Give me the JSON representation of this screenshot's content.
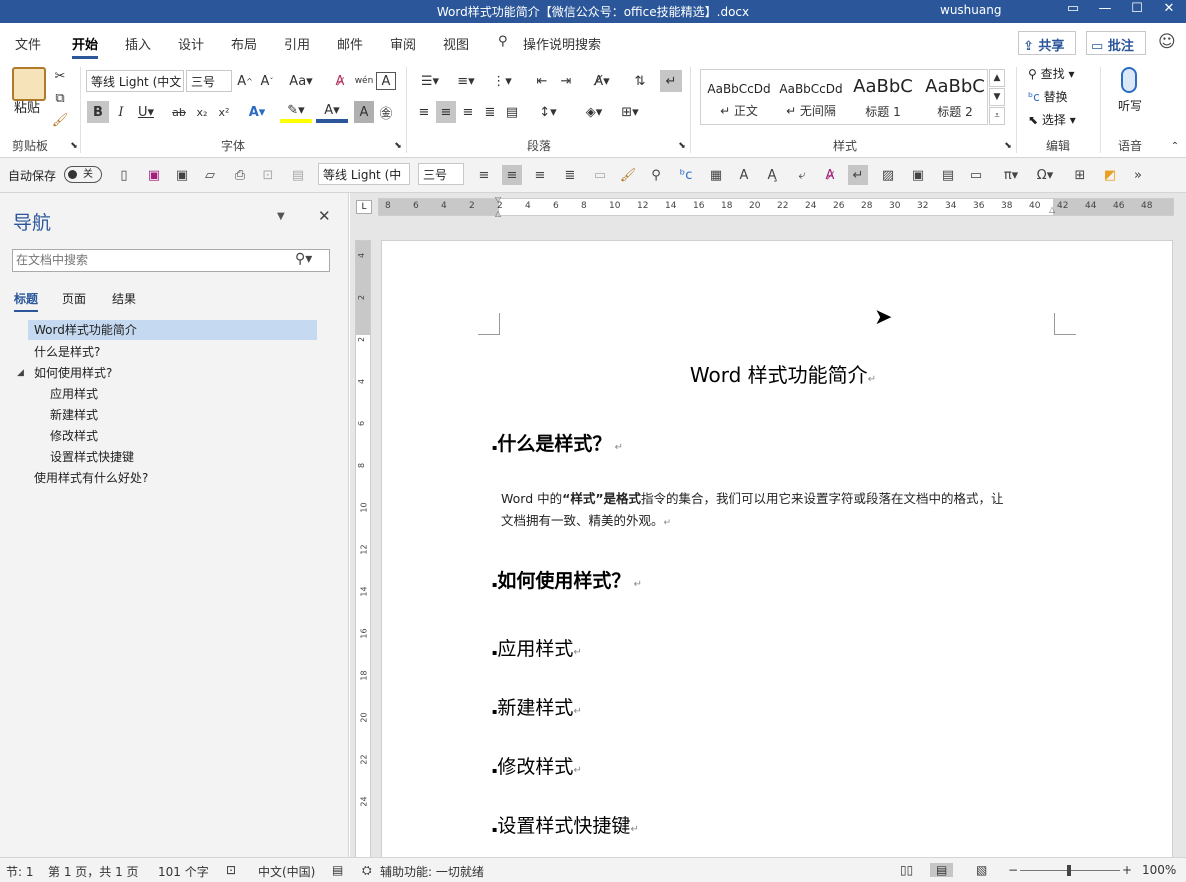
{
  "window": {
    "title": "Word样式功能简介【微信公众号：office技能精选】.docx",
    "user": "wushuang"
  },
  "tabs": [
    "文件",
    "开始",
    "插入",
    "设计",
    "布局",
    "引用",
    "邮件",
    "审阅",
    "视图"
  ],
  "tell_me": "操作说明搜索",
  "share": "共享",
  "comment": "批注",
  "ribbon": {
    "clipboard": {
      "paste": "粘贴",
      "label": "剪贴板"
    },
    "font": {
      "name": "等线 Light (中文",
      "size": "三号",
      "label": "字体",
      "aa": "Aa"
    },
    "paragraph": {
      "label": "段落"
    },
    "styles": {
      "label": "样式",
      "items": [
        {
          "sample": "AaBbCcDd",
          "name": "↵ 正文"
        },
        {
          "sample": "AaBbCcDd",
          "name": "↵ 无间隔"
        },
        {
          "sample": "AaBbC",
          "name": "标题 1"
        },
        {
          "sample": "AaBbC",
          "name": "标题 2"
        }
      ]
    },
    "editing": {
      "find": "查找",
      "replace": "替换",
      "select": "选择",
      "label": "编辑"
    },
    "voice": {
      "dictate": "听写",
      "label": "语音"
    }
  },
  "qat": {
    "autosave": "自动保存",
    "toggle": "关",
    "font": "等线 Light (中",
    "size": "三号"
  },
  "nav": {
    "title": "导航",
    "search_placeholder": "在文档中搜索",
    "tabs": [
      "标题",
      "页面",
      "结果"
    ],
    "items": [
      "Word样式功能简介",
      "什么是样式?",
      "如何使用样式?",
      "应用样式",
      "新建样式",
      "修改样式",
      "设置样式快捷键",
      "使用样式有什么好处?"
    ]
  },
  "ruler": {
    "h": [
      "8",
      "6",
      "4",
      "2",
      "2",
      "4",
      "6",
      "8",
      "10",
      "12",
      "14",
      "16",
      "18",
      "20",
      "22",
      "24",
      "26",
      "28",
      "30",
      "32",
      "34",
      "36",
      "38",
      "40",
      "42",
      "44",
      "46",
      "48"
    ],
    "v": [
      "4",
      "2",
      "2",
      "4",
      "6",
      "8",
      "10",
      "12",
      "14",
      "16",
      "18",
      "20",
      "22",
      "24"
    ]
  },
  "doc": {
    "title": "Word 样式功能简介",
    "h_what": "什么是样式？",
    "para_pre": "Word 中的",
    "para_b1": "“样式”是格式",
    "para_mid": "指令的集合，我们可以用它来设置字符或段落在文档中的格式，让",
    "para_line2": "文档拥有一致、精美的外观。",
    "h_how": "如何使用样式？",
    "sub": [
      "应用样式",
      "新建样式",
      "修改样式",
      "设置样式快捷键"
    ]
  },
  "status": {
    "section": "节: 1",
    "page": "第 1 页，共 1 页",
    "words": "101 个字",
    "lang": "中文(中国)",
    "accessibility": "辅助功能: 一切就绪",
    "zoom": "100%"
  },
  "colors": {
    "titlebar": "#2b579a",
    "nav_selected": "#c5d9f1",
    "accent": "#2b579a"
  }
}
